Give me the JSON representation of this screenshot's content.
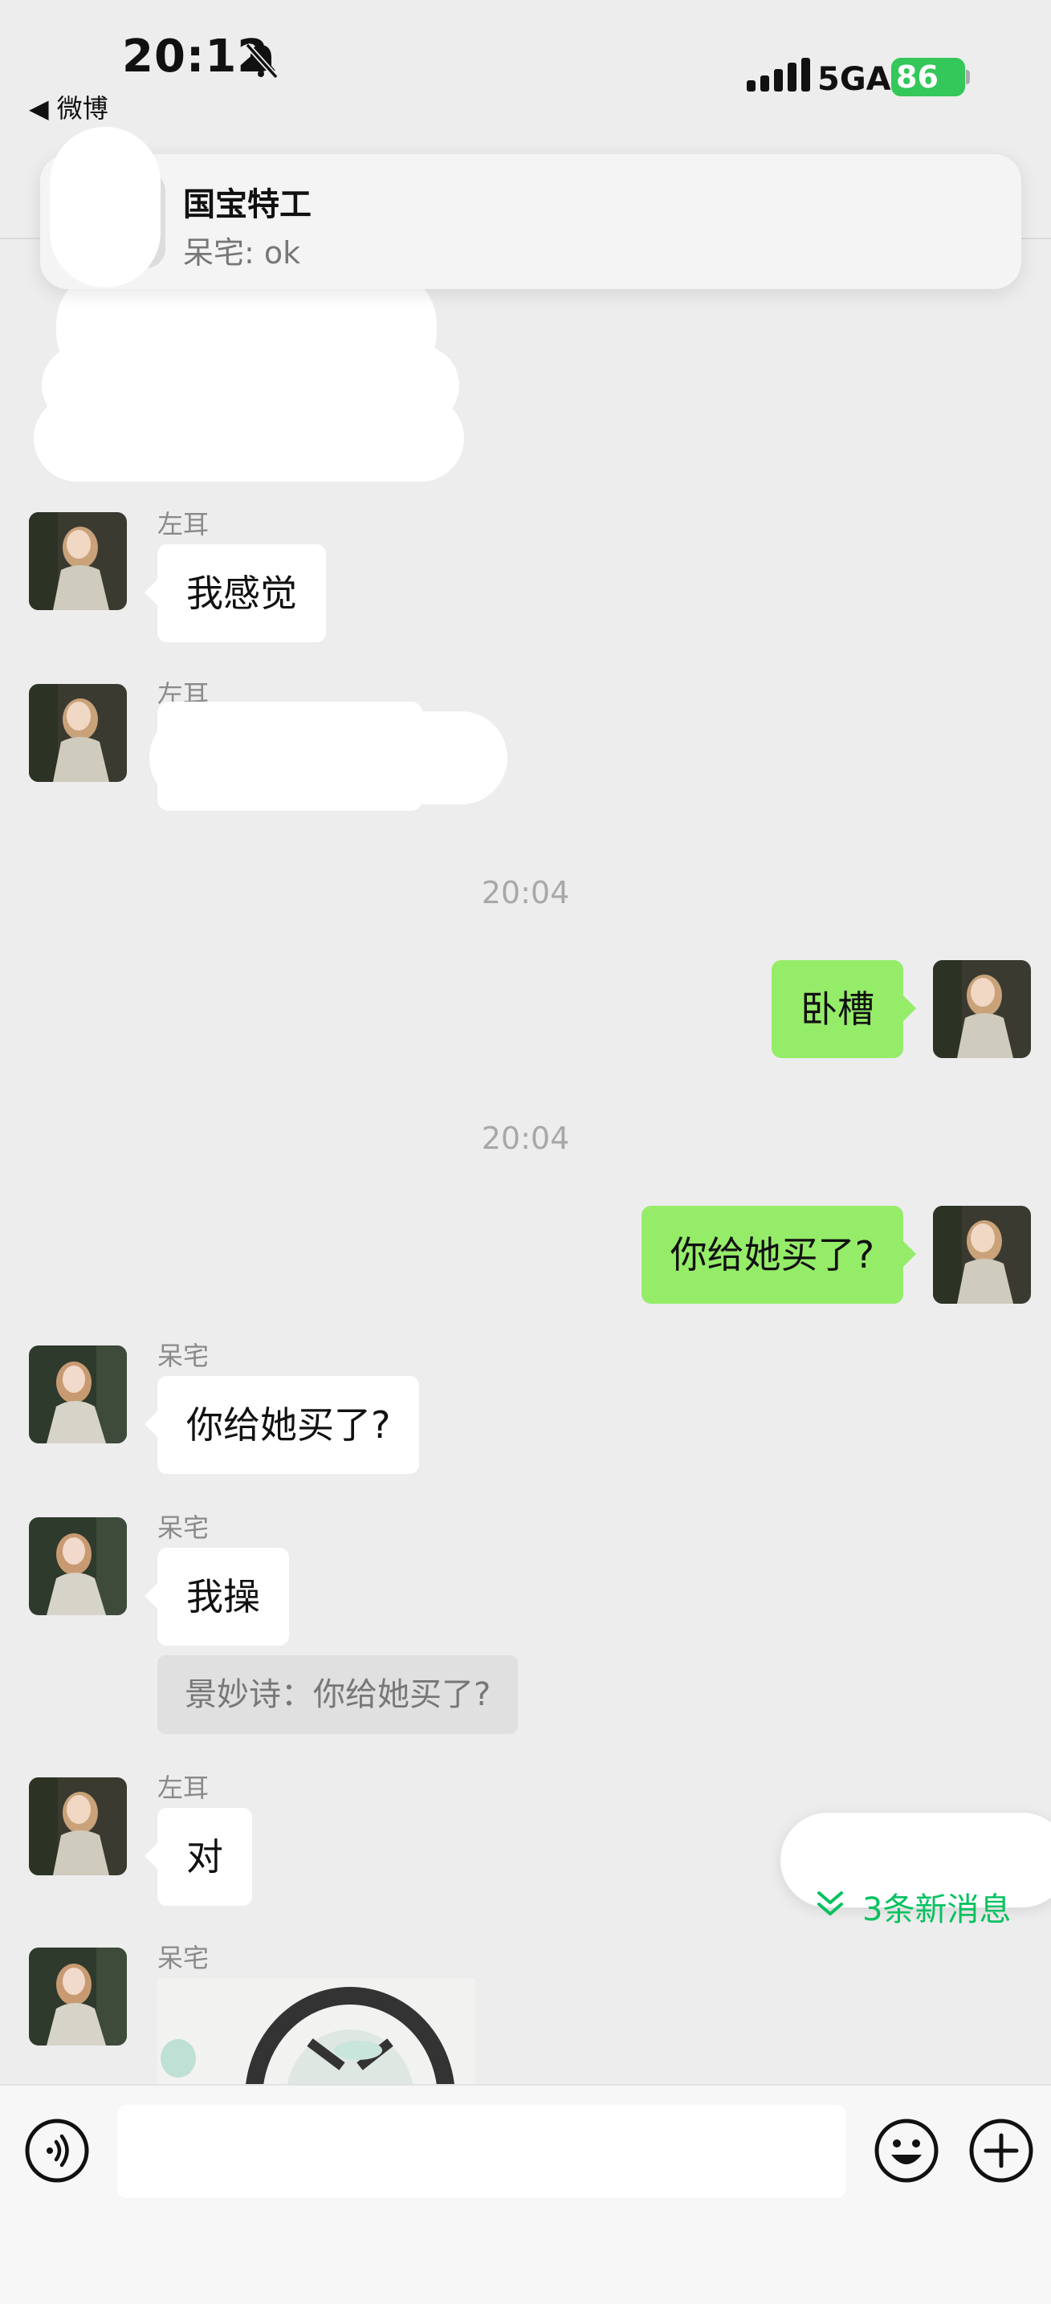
{
  "status_bar": {
    "time": "20:12",
    "back_app": "◀ 微博",
    "network": "5GA",
    "battery": "86"
  },
  "notification": {
    "title": "国宝特工",
    "message": "呆宅: ok"
  },
  "messages": [
    {
      "side": "left",
      "sender": "左耳",
      "text": "我感觉"
    },
    {
      "side": "left",
      "sender": "左耳",
      "text": ""
    },
    {
      "type": "timestamp",
      "text": "20:04"
    },
    {
      "side": "right",
      "text": "卧槽"
    },
    {
      "type": "timestamp",
      "text": "20:04"
    },
    {
      "side": "right",
      "text": "你给她买了?"
    },
    {
      "side": "left",
      "sender": "呆宅",
      "text": "你给她买了?"
    },
    {
      "side": "left",
      "sender": "呆宅",
      "text": "我操",
      "quote": "景妙诗：你给她买了?"
    },
    {
      "side": "left",
      "sender": "左耳",
      "text": "对"
    },
    {
      "side": "left",
      "sender": "呆宅",
      "type": "sticker"
    }
  ],
  "new_messages_pill": {
    "label": "3条新消息"
  },
  "input_bar": {
    "placeholder": "",
    "icons": [
      "voice-icon",
      "emoji-icon",
      "plus-icon"
    ]
  },
  "colors": {
    "background": "#ededed",
    "outgoing_bubble": "#95ec69",
    "incoming_bubble": "#ffffff",
    "accent": "#07c160"
  }
}
